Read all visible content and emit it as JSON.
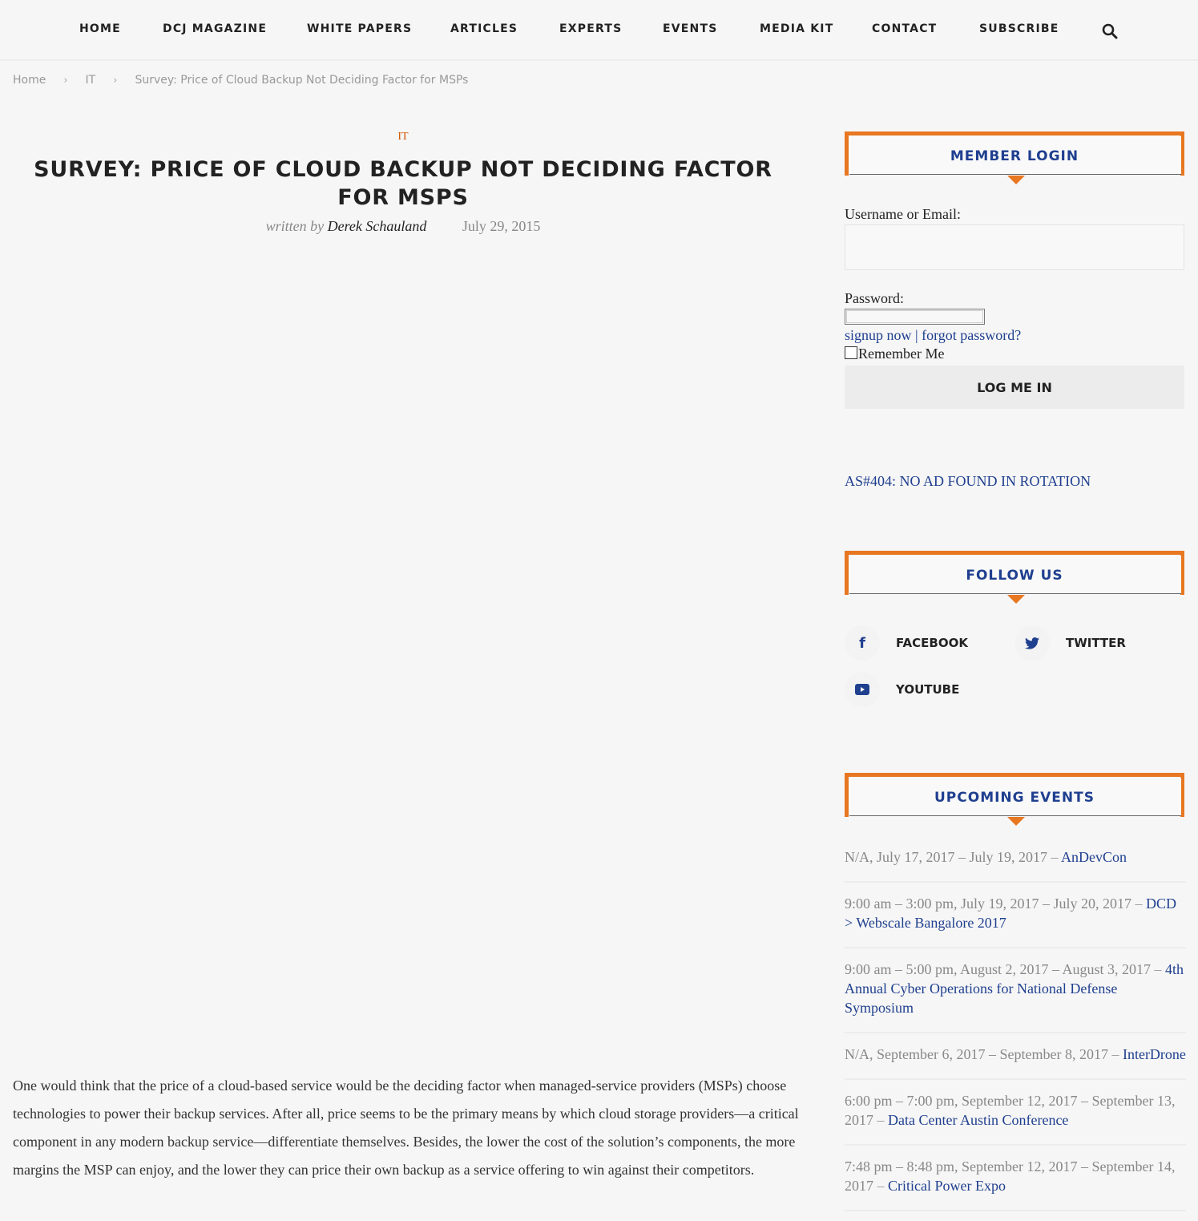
{
  "nav": {
    "items": [
      "HOME",
      "DCJ MAGAZINE",
      "WHITE PAPERS",
      "ARTICLES",
      "EXPERTS",
      "EVENTS",
      "MEDIA KIT",
      "CONTACT",
      "SUBSCRIBE"
    ],
    "search_icon": "search-icon"
  },
  "breadcrumb": {
    "items": [
      "Home",
      "IT",
      "Survey: Price of Cloud Backup Not Deciding Factor for MSPs"
    ],
    "separator": "›"
  },
  "article": {
    "category": "IT",
    "title": "SURVEY: PRICE OF CLOUD BACKUP NOT DECIDING FACTOR FOR MSPS",
    "written_by": "written by",
    "author": "Derek Schauland",
    "date": "July 29, 2015",
    "body": "One would think that the price of a cloud-based service would be the deciding factor when managed-service providers (MSPs) choose technologies to power their backup services. After all, price seems to be the primary means by which cloud storage providers—a critical component in any modern backup service—differentiate themselves. Besides, the lower the cost of the solution’s components, the more margins the MSP can enjoy, and the lower they can price their own backup as a service offering to win against their competitors."
  },
  "sidebar": {
    "login": {
      "title": "MEMBER LOGIN",
      "username_label": "Username or Email:",
      "username_value": "",
      "password_label": "Password:",
      "password_value": "",
      "signup_link": "signup now",
      "links_separator": " | ",
      "forgot_link": "forgot password?",
      "remember_label": "Remember Me",
      "remember_checked": false,
      "submit_label": "LOG ME IN"
    },
    "ad_text": "AS#404: NO AD FOUND IN ROTATION",
    "follow": {
      "title": "FOLLOW US",
      "items": [
        {
          "label": "FACEBOOK",
          "icon": "facebook-icon"
        },
        {
          "label": "TWITTER",
          "icon": "twitter-icon"
        },
        {
          "label": "YOUTUBE",
          "icon": "youtube-icon"
        }
      ]
    },
    "events": {
      "title": "UPCOMING EVENTS",
      "items": [
        {
          "when": "N/A, July 17, 2017 – July 19, 2017",
          "name": "AnDevCon"
        },
        {
          "when": "9:00 am – 3:00 pm, July 19, 2017 – July 20, 2017",
          "name": "DCD > Webscale Bangalore 2017"
        },
        {
          "when": "9:00 am – 5:00 pm, August 2, 2017 – August 3, 2017",
          "name": "4th Annual Cyber Operations for National Defense Symposium"
        },
        {
          "when": "N/A, September 6, 2017 – September 8, 2017",
          "name": "InterDrone"
        },
        {
          "when": "6:00 pm – 7:00 pm, September 12, 2017 – September 13, 2017",
          "name": "Data Center Austin Conference"
        },
        {
          "when": "7:48 pm – 8:48 pm, September 12, 2017 – September 14, 2017",
          "name": "Critical Power Expo"
        }
      ],
      "dash": " – "
    }
  },
  "colors": {
    "accent_orange": "#e87722",
    "link_blue": "#1f3f8f",
    "category_orange": "#d35400",
    "background": "#f6f6f6"
  }
}
